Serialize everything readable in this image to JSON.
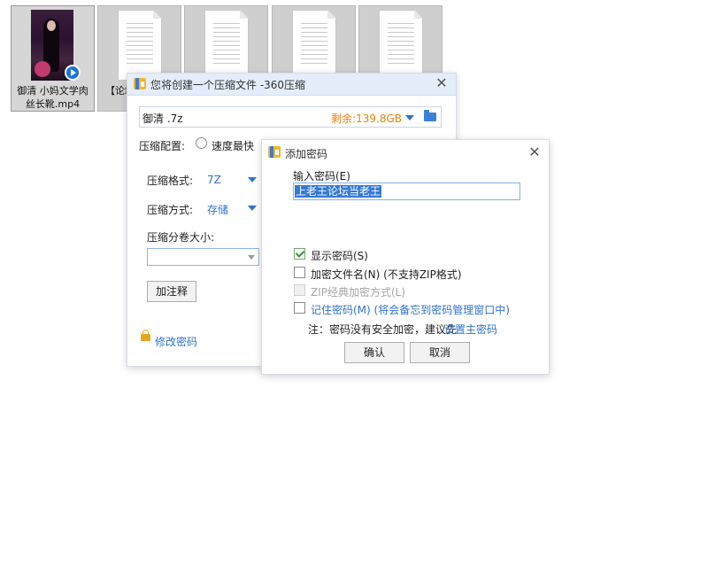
{
  "desktop": {
    "files": [
      {
        "name": "御清 小妈文学肉丝长靴.mp4",
        "type": "video"
      },
      {
        "name": "【论坛",
        "type": "document"
      },
      {
        "name": "",
        "type": "document"
      },
      {
        "name": "",
        "type": "document"
      },
      {
        "name": "",
        "type": "document"
      }
    ]
  },
  "main_dialog": {
    "title": "您将创建一个压缩文件 -360压缩",
    "path_name": "御清 .7z",
    "free_space": "剩余:139.8GB",
    "config_label": "压缩配置:",
    "config_option_fast": "速度最快",
    "format_label": "压缩格式:",
    "format_value": "7Z",
    "method_label": "压缩方式:",
    "method_value": "存储",
    "split_label": "压缩分卷大小:",
    "comment_button": "加注释",
    "change_password_link": "修改密码"
  },
  "password_dialog": {
    "title": "添加密码",
    "input_label": "输入密码(E)",
    "password_value": "上老王论坛当老王",
    "show_password_label": "显示密码(S)",
    "show_password_checked": true,
    "encrypt_filename_label": "加密文件名(N) (不支持ZIP格式)",
    "zip_classic_label": "ZIP经典加密方式(L)",
    "remember_password_label": "记住密码(M) (将会备忘到密码管理窗口中)",
    "note_prefix": "注：密码没有安全加密，建议先",
    "note_link": "设置主密码",
    "ok_button": "确认",
    "cancel_button": "取消"
  },
  "colors": {
    "accent_blue": "#2f73d0",
    "free_space_orange": "#e8820c",
    "titlebar_bg": "#e4eefb",
    "selection_blue": "#3379d6"
  }
}
